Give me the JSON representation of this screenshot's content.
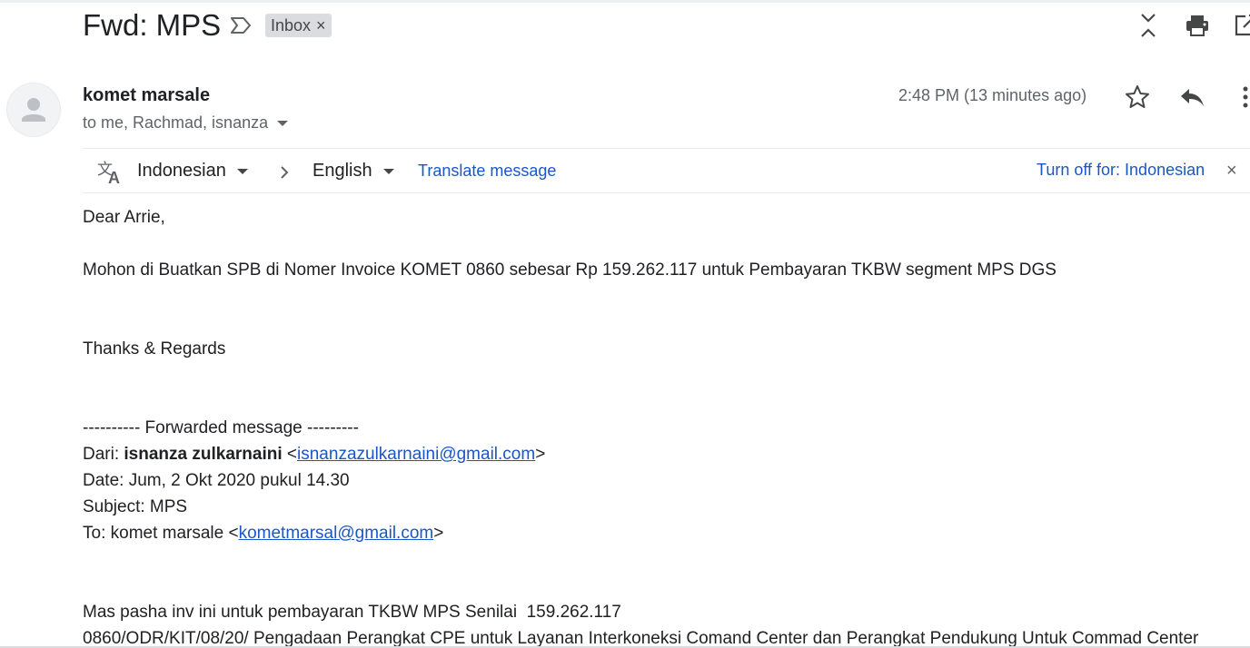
{
  "email": {
    "subject": "Fwd: MPS",
    "label": "Inbox",
    "label_remove": "×",
    "sender": "komet marsale",
    "recipients": "to me, Rachmad, isnanza",
    "time": "2:48 PM (13 minutes ago)"
  },
  "translate": {
    "source_language": "Indonesian",
    "target_language": "English",
    "translate_link": "Translate message",
    "turn_off_link": "Turn off for: Indonesian",
    "close": "×"
  },
  "body": {
    "greeting": "Dear Arrie,",
    "line1": "Mohon di Buatkan SPB di Nomer Invoice KOMET 0860 sebesar Rp 159.262.117 untuk Pembayaran TKBW segment MPS DGS",
    "closing": "Thanks & Regards",
    "forwarded_header": "---------- Forwarded message ---------",
    "from_label": "Dari: ",
    "from_name": "isnanza zulkarnaini",
    "from_open": " <",
    "from_email": "isnanzazulkarnaini@gmail.com",
    "from_close": ">",
    "date_line": "Date: Jum, 2 Okt 2020 pukul 14.30",
    "subject_line": "Subject: MPS",
    "to_label": "To: komet marsale <",
    "to_email": "kometmarsal@gmail.com",
    "to_close": ">",
    "message_line1": "Mas pasha inv ini untuk pembayaran TKBW MPS Senilai  159.262.117",
    "message_line2": "0860/ODR/KIT/08/20/ Pengadaan Perangkat CPE untuk Layanan Interkoneksi Comand Center dan Perangkat Pendukung Untuk Commad Center"
  },
  "icons": {
    "important": "important-marker-icon",
    "collapse": "collapse-all-icon",
    "print": "print-icon",
    "new_window": "open-in-new-window-icon",
    "avatar": "person-icon",
    "star": "star-icon",
    "reply": "reply-icon",
    "more": "more-vert-icon",
    "translate": "translate-icon",
    "chevron": "chevron-right-icon"
  },
  "colors": {
    "link": "#1a57c6",
    "secondary_text": "#5f6368",
    "chip_bg": "#dadce0"
  }
}
